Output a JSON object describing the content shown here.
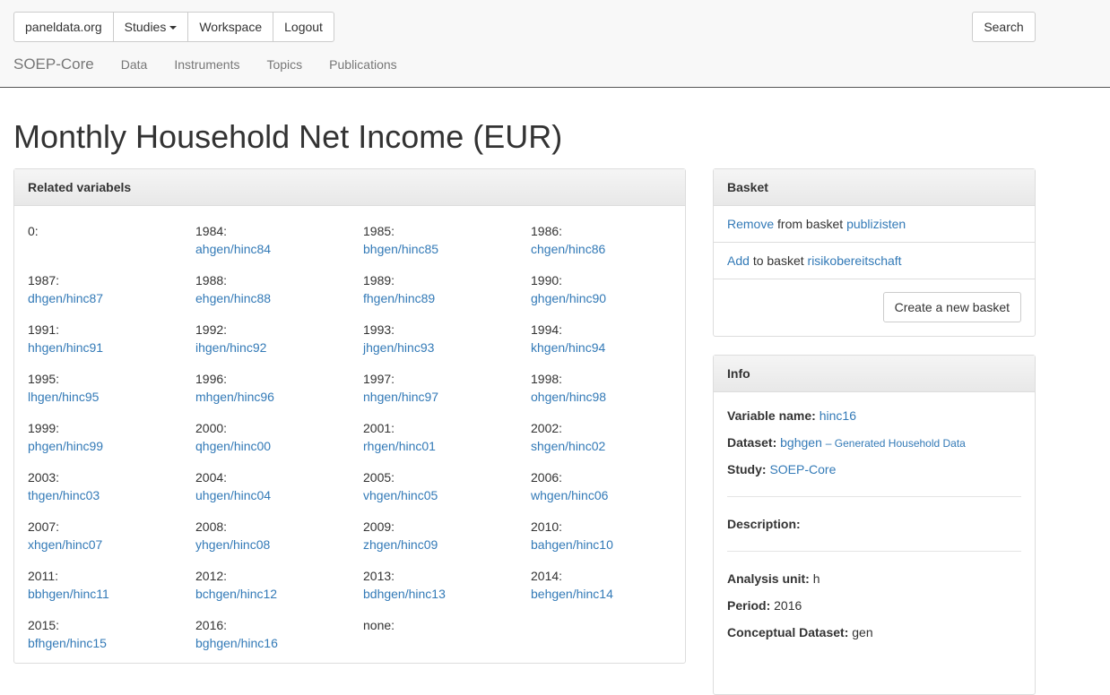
{
  "navbar": {
    "buttons": {
      "paneldata": "paneldata.org",
      "studies": "Studies",
      "workspace": "Workspace",
      "logout": "Logout"
    },
    "search": "Search",
    "brand": "SOEP-Core",
    "links": [
      "Data",
      "Instruments",
      "Topics",
      "Publications"
    ]
  },
  "title": "Monthly Household Net Income (EUR)",
  "related": {
    "heading": "Related variabels",
    "items": [
      {
        "year": "0:",
        "link": ""
      },
      {
        "year": "1984:",
        "link": "ahgen/hinc84"
      },
      {
        "year": "1985:",
        "link": "bhgen/hinc85"
      },
      {
        "year": "1986:",
        "link": "chgen/hinc86"
      },
      {
        "year": "1987:",
        "link": "dhgen/hinc87"
      },
      {
        "year": "1988:",
        "link": "ehgen/hinc88"
      },
      {
        "year": "1989:",
        "link": "fhgen/hinc89"
      },
      {
        "year": "1990:",
        "link": "ghgen/hinc90"
      },
      {
        "year": "1991:",
        "link": "hhgen/hinc91"
      },
      {
        "year": "1992:",
        "link": "ihgen/hinc92"
      },
      {
        "year": "1993:",
        "link": "jhgen/hinc93"
      },
      {
        "year": "1994:",
        "link": "khgen/hinc94"
      },
      {
        "year": "1995:",
        "link": "lhgen/hinc95"
      },
      {
        "year": "1996:",
        "link": "mhgen/hinc96"
      },
      {
        "year": "1997:",
        "link": "nhgen/hinc97"
      },
      {
        "year": "1998:",
        "link": "ohgen/hinc98"
      },
      {
        "year": "1999:",
        "link": "phgen/hinc99"
      },
      {
        "year": "2000:",
        "link": "qhgen/hinc00"
      },
      {
        "year": "2001:",
        "link": "rhgen/hinc01"
      },
      {
        "year": "2002:",
        "link": "shgen/hinc02"
      },
      {
        "year": "2003:",
        "link": "thgen/hinc03"
      },
      {
        "year": "2004:",
        "link": "uhgen/hinc04"
      },
      {
        "year": "2005:",
        "link": "vhgen/hinc05"
      },
      {
        "year": "2006:",
        "link": "whgen/hinc06"
      },
      {
        "year": "2007:",
        "link": "xhgen/hinc07"
      },
      {
        "year": "2008:",
        "link": "yhgen/hinc08"
      },
      {
        "year": "2009:",
        "link": "zhgen/hinc09"
      },
      {
        "year": "2010:",
        "link": "bahgen/hinc10"
      },
      {
        "year": "2011:",
        "link": "bbhgen/hinc11"
      },
      {
        "year": "2012:",
        "link": "bchgen/hinc12"
      },
      {
        "year": "2013:",
        "link": "bdhgen/hinc13"
      },
      {
        "year": "2014:",
        "link": "behgen/hinc14"
      },
      {
        "year": "2015:",
        "link": "bfhgen/hinc15"
      },
      {
        "year": "2016:",
        "link": "bghgen/hinc16"
      },
      {
        "year": "none:",
        "link": ""
      }
    ]
  },
  "basket": {
    "heading": "Basket",
    "remove_action": "Remove",
    "remove_text": "from basket",
    "remove_name": "publizisten",
    "add_action": "Add",
    "add_text": "to basket",
    "add_name": "risikobereitschaft",
    "create_button": "Create a new basket"
  },
  "info": {
    "heading": "Info",
    "variable_label": "Variable name:",
    "variable_value": "hinc16",
    "dataset_label": "Dataset:",
    "dataset_value": "bghgen",
    "dataset_note": "– Generated Household Data",
    "study_label": "Study:",
    "study_value": "SOEP-Core",
    "description_label": "Description:",
    "analysis_label": "Analysis unit:",
    "analysis_value": "h",
    "period_label": "Period:",
    "period_value": "2016",
    "conceptual_label": "Conceptual Dataset:",
    "conceptual_value": "gen"
  }
}
